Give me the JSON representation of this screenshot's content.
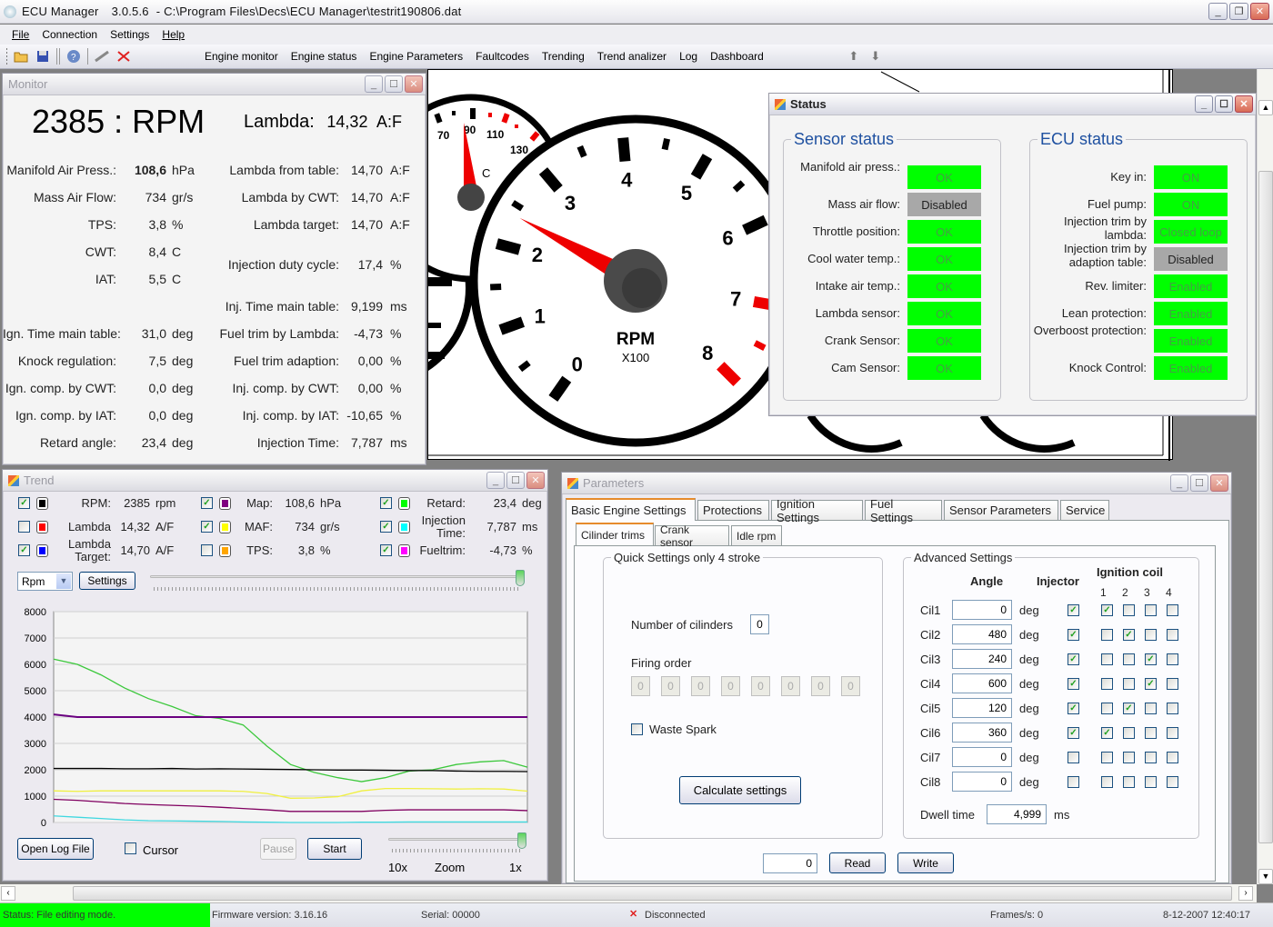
{
  "window": {
    "app_name": "ECU Manager",
    "version": "3.0.5.6",
    "file_path": "- C:\\Program Files\\Decs\\ECU Manager\\testrit190806.dat"
  },
  "menu": [
    "File",
    "Connection",
    "Settings",
    "Help"
  ],
  "toolbar": {
    "icons": [
      "open-folder-icon",
      "save-icon",
      "help-icon",
      "connect-icon",
      "disconnect-icon"
    ],
    "nav": [
      "Engine monitor",
      "Engine status",
      "Engine Parameters",
      "Faultcodes",
      "Trending",
      "Trend analizer",
      "Log",
      "Dashboard"
    ],
    "arrows": [
      "up-arrow-icon",
      "down-arrow-icon"
    ]
  },
  "monitor": {
    "title": "Monitor",
    "rpm_value": "2385",
    "rpm_sep": ":",
    "rpm_unit": "RPM",
    "lambda_label": "Lambda:",
    "lambda_value": "14,32",
    "lambda_unit": "A:F",
    "left": [
      {
        "label": "Manifold Air Press.:",
        "value": "108,6",
        "unit": "hPa"
      },
      {
        "label": "Mass Air Flow:",
        "value": "734",
        "unit": "gr/s"
      },
      {
        "label": "TPS:",
        "value": "3,8",
        "unit": "%"
      },
      {
        "label": "CWT:",
        "value": "8,4",
        "unit": "C"
      },
      {
        "label": "IAT:",
        "value": "5,5",
        "unit": "C"
      },
      {
        "label": "Ign. Time main table:",
        "value": "31,0",
        "unit": "deg"
      },
      {
        "label": "Knock regulation:",
        "value": "7,5",
        "unit": "deg"
      },
      {
        "label": "Ign. comp. by CWT:",
        "value": "0,0",
        "unit": "deg"
      },
      {
        "label": "Ign. comp. by IAT:",
        "value": "0,0",
        "unit": "deg"
      },
      {
        "label": "Retard angle:",
        "value": "23,4",
        "unit": "deg"
      }
    ],
    "right": [
      {
        "label": "Lambda from table:",
        "value": "14,70",
        "unit": "A:F"
      },
      {
        "label": "Lambda by CWT:",
        "value": "14,70",
        "unit": "A:F"
      },
      {
        "label": "Lambda target:",
        "value": "14,70",
        "unit": "A:F"
      },
      {
        "label": "Injection duty cycle:",
        "value": "17,4",
        "unit": "%"
      },
      {
        "label": "Inj. Time main table:",
        "value": "9,199",
        "unit": "ms"
      },
      {
        "label": "Fuel trim by Lambda:",
        "value": "-4,73",
        "unit": "%"
      },
      {
        "label": "Fuel trim adaption:",
        "value": "0,00",
        "unit": "%"
      },
      {
        "label": "Inj. comp. by CWT:",
        "value": "0,00",
        "unit": "%"
      },
      {
        "label": "Inj. comp. by IAT:",
        "value": "-10,65",
        "unit": "%"
      },
      {
        "label": "Injection Time:",
        "value": "7,787",
        "unit": "ms"
      }
    ]
  },
  "dashboard": {
    "rpm_gauge": {
      "label": "RPM",
      "sublabel": "X100",
      "ticks": [
        "0",
        "1",
        "2",
        "3",
        "4",
        "5",
        "6",
        "7",
        "8"
      ],
      "value": 2.385,
      "max": 8
    },
    "temp_gauge": {
      "unit": "C",
      "ticks": [
        "70",
        "90",
        "110",
        "130"
      ],
      "value": 90
    }
  },
  "status": {
    "title": "Status",
    "sensor_title": "Sensor status",
    "ecu_title": "ECU status",
    "sensors": [
      {
        "label": "Manifold air press.:",
        "state": "OK",
        "ok": true
      },
      {
        "label": "Mass air flow:",
        "state": "Disabled",
        "ok": false
      },
      {
        "label": "Throttle position:",
        "state": "OK",
        "ok": true
      },
      {
        "label": "Cool water temp.:",
        "state": "OK",
        "ok": true
      },
      {
        "label": "Intake air temp.:",
        "state": "OK",
        "ok": true
      },
      {
        "label": "Lambda sensor:",
        "state": "OK",
        "ok": true
      },
      {
        "label": "Crank Sensor:",
        "state": "OK",
        "ok": true
      },
      {
        "label": "Cam Sensor:",
        "state": "OK",
        "ok": true
      }
    ],
    "ecu": [
      {
        "label": "Key in:",
        "state": "ON",
        "ok": true
      },
      {
        "label": "Fuel pump:",
        "state": "ON",
        "ok": true
      },
      {
        "label": "Injection trim by lambda:",
        "state": "Closed loop",
        "ok": true
      },
      {
        "label": "Injection trim by adaption table:",
        "state": "Disabled",
        "ok": false
      },
      {
        "label": "Rev. limiter:",
        "state": "Enabled",
        "ok": true
      },
      {
        "label": "Lean protection:",
        "state": "Enabled",
        "ok": true
      },
      {
        "label": "Overboost protection:",
        "state": "Enabled",
        "ok": true
      },
      {
        "label": "Knock Control:",
        "state": "Enabled",
        "ok": true
      }
    ]
  },
  "trend": {
    "title": "Trend",
    "channels": [
      {
        "checked": true,
        "color": "#000000",
        "label": "RPM:",
        "value": "2385",
        "unit": "rpm"
      },
      {
        "checked": false,
        "color": "#ff0000",
        "label": "Lambda",
        "value": "14,32",
        "unit": "A/F"
      },
      {
        "checked": true,
        "color": "#0000ff",
        "label": "Lambda Target:",
        "value": "14,70",
        "unit": "A/F"
      },
      {
        "checked": true,
        "color": "#800080",
        "label": "Map:",
        "value": "108,6",
        "unit": "hPa"
      },
      {
        "checked": true,
        "color": "#ffff00",
        "label": "MAF:",
        "value": "734",
        "unit": "gr/s"
      },
      {
        "checked": false,
        "color": "#ffa500",
        "label": "TPS:",
        "value": "3,8",
        "unit": "%"
      },
      {
        "checked": true,
        "color": "#00ff00",
        "label": "Retard:",
        "value": "23,4",
        "unit": "deg"
      },
      {
        "checked": true,
        "color": "#00ffff",
        "label": "Injection Time:",
        "value": "7,787",
        "unit": "ms"
      },
      {
        "checked": true,
        "color": "#ff00ff",
        "label": "Fueltrim:",
        "value": "-4,73",
        "unit": "%"
      }
    ],
    "scale_select": "Rpm",
    "settings_label": "Settings",
    "open_log_label": "Open Log File",
    "cursor_label": "Cursor",
    "cursor_checked": false,
    "pause_label": "Pause",
    "start_label": "Start",
    "zoom_labels": [
      "10x",
      "Zoom",
      "1x"
    ],
    "position_slider": 1.0,
    "zoom_slider": 1.0
  },
  "chart_data": {
    "type": "line",
    "title": "",
    "xlabel": "",
    "ylabel": "",
    "ylim": [
      0,
      8000
    ],
    "yticks": [
      "0",
      "1000",
      "2000",
      "3000",
      "4000",
      "5000",
      "6000",
      "7000",
      "8000"
    ],
    "grid": true,
    "x": [
      0,
      5,
      10,
      15,
      20,
      25,
      30,
      35,
      40,
      45,
      50,
      55,
      60,
      65,
      70,
      75,
      80,
      85,
      90,
      95,
      100
    ],
    "series": [
      {
        "name": "Retard",
        "color": "#3cc83c",
        "values": [
          6200,
          6000,
          5600,
          5100,
          4700,
          4400,
          4050,
          3950,
          3700,
          2900,
          2200,
          1900,
          1700,
          1550,
          1700,
          1950,
          2000,
          2200,
          2300,
          2350,
          2100
        ]
      },
      {
        "name": "Map",
        "color": "#6a0080",
        "values": [
          4100,
          4000,
          4000,
          4000,
          4000,
          4000,
          4000,
          4000,
          4000,
          4000,
          4000,
          4000,
          4000,
          4000,
          4000,
          4000,
          4000,
          4000,
          4000,
          4000,
          4000
        ]
      },
      {
        "name": "RPM",
        "color": "#000000",
        "values": [
          2050,
          2050,
          2050,
          2040,
          2040,
          2050,
          2030,
          2040,
          2030,
          2020,
          2010,
          2000,
          1990,
          1990,
          1980,
          1970,
          1970,
          1950,
          1940,
          1940,
          1930
        ]
      },
      {
        "name": "MAF",
        "color": "#f0f040",
        "values": [
          1200,
          1180,
          1200,
          1200,
          1200,
          1200,
          1200,
          1200,
          1180,
          1100,
          920,
          930,
          980,
          1200,
          1290,
          1290,
          1280,
          1270,
          1280,
          1270,
          1190
        ]
      },
      {
        "name": "Fueltrim",
        "color": "#800060",
        "values": [
          880,
          840,
          780,
          720,
          680,
          650,
          620,
          580,
          530,
          480,
          420,
          420,
          420,
          420,
          460,
          480,
          480,
          480,
          480,
          480,
          450
        ]
      },
      {
        "name": "Injection Time",
        "color": "#40d8e0",
        "values": [
          250,
          200,
          150,
          100,
          70,
          60,
          50,
          40,
          20,
          10,
          0,
          0,
          0,
          10,
          10,
          20,
          20,
          20,
          20,
          20,
          20
        ]
      }
    ]
  },
  "parameters": {
    "title": "Parameters",
    "tabs": [
      "Basic Engine Settings",
      "Protections",
      "Ignition Settings",
      "Fuel Settings",
      "Sensor Parameters",
      "Service"
    ],
    "subtabs": [
      "Cilinder trims",
      "Crank sensor",
      "Idle rpm"
    ],
    "quick": {
      "title": "Quick Settings only 4 stroke",
      "num_cyl_label": "Number of cilinders",
      "num_cyl_value": "0",
      "firing_label": "Firing order",
      "firing_order": [
        "0",
        "0",
        "0",
        "0",
        "0",
        "0",
        "0",
        "0"
      ],
      "waste_spark_label": "Waste Spark",
      "waste_spark": false,
      "calc_label": "Calculate settings"
    },
    "advanced": {
      "title": "Advanced Settings",
      "angle_header": "Angle",
      "injector_header": "Injector",
      "coil_header": "Ignition coil",
      "coil_numbers": [
        "1",
        "2",
        "3",
        "4"
      ],
      "unit": "deg",
      "rows": [
        {
          "name": "Cil1",
          "angle": "0",
          "injector": true,
          "coils": [
            true,
            false,
            false,
            false
          ]
        },
        {
          "name": "Cil2",
          "angle": "480",
          "injector": true,
          "coils": [
            false,
            true,
            false,
            false
          ]
        },
        {
          "name": "Cil3",
          "angle": "240",
          "injector": true,
          "coils": [
            false,
            false,
            true,
            false
          ]
        },
        {
          "name": "Cil4",
          "angle": "600",
          "injector": true,
          "coils": [
            false,
            false,
            true,
            false
          ]
        },
        {
          "name": "Cil5",
          "angle": "120",
          "injector": true,
          "coils": [
            false,
            true,
            false,
            false
          ]
        },
        {
          "name": "Cil6",
          "angle": "360",
          "injector": true,
          "coils": [
            true,
            false,
            false,
            false
          ]
        },
        {
          "name": "Cil7",
          "angle": "0",
          "injector": false,
          "coils": [
            false,
            false,
            false,
            false
          ]
        },
        {
          "name": "Cil8",
          "angle": "0",
          "injector": false,
          "coils": [
            false,
            false,
            false,
            false
          ]
        }
      ],
      "dwell_label": "Dwell time",
      "dwell_value": "4,999",
      "dwell_unit": "ms"
    },
    "address_value": "0",
    "read_label": "Read",
    "write_label": "Write"
  },
  "statusbar": {
    "status": "Status: File editing mode.",
    "firmware": "Firmware version: 3.16.16",
    "serial": "Serial: 00000",
    "connection": "Disconnected",
    "frames": "Frames/s: 0",
    "datetime": "8-12-2007 12:40:17",
    "status_color": "#00ff00"
  }
}
